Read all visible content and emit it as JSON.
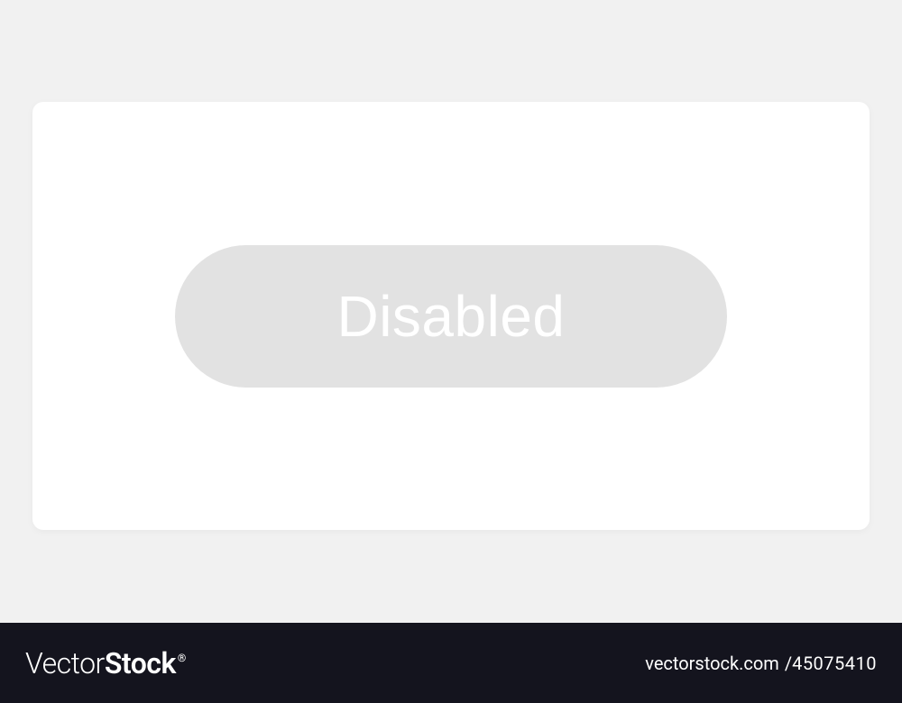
{
  "card": {
    "button_label": "Disabled"
  },
  "footer": {
    "brand_prefix": "Vector",
    "brand_suffix": "Stock",
    "brand_reg": "®",
    "stock_label": "vectorstock.com",
    "stock_separator": "/",
    "stock_id": "45075410"
  }
}
